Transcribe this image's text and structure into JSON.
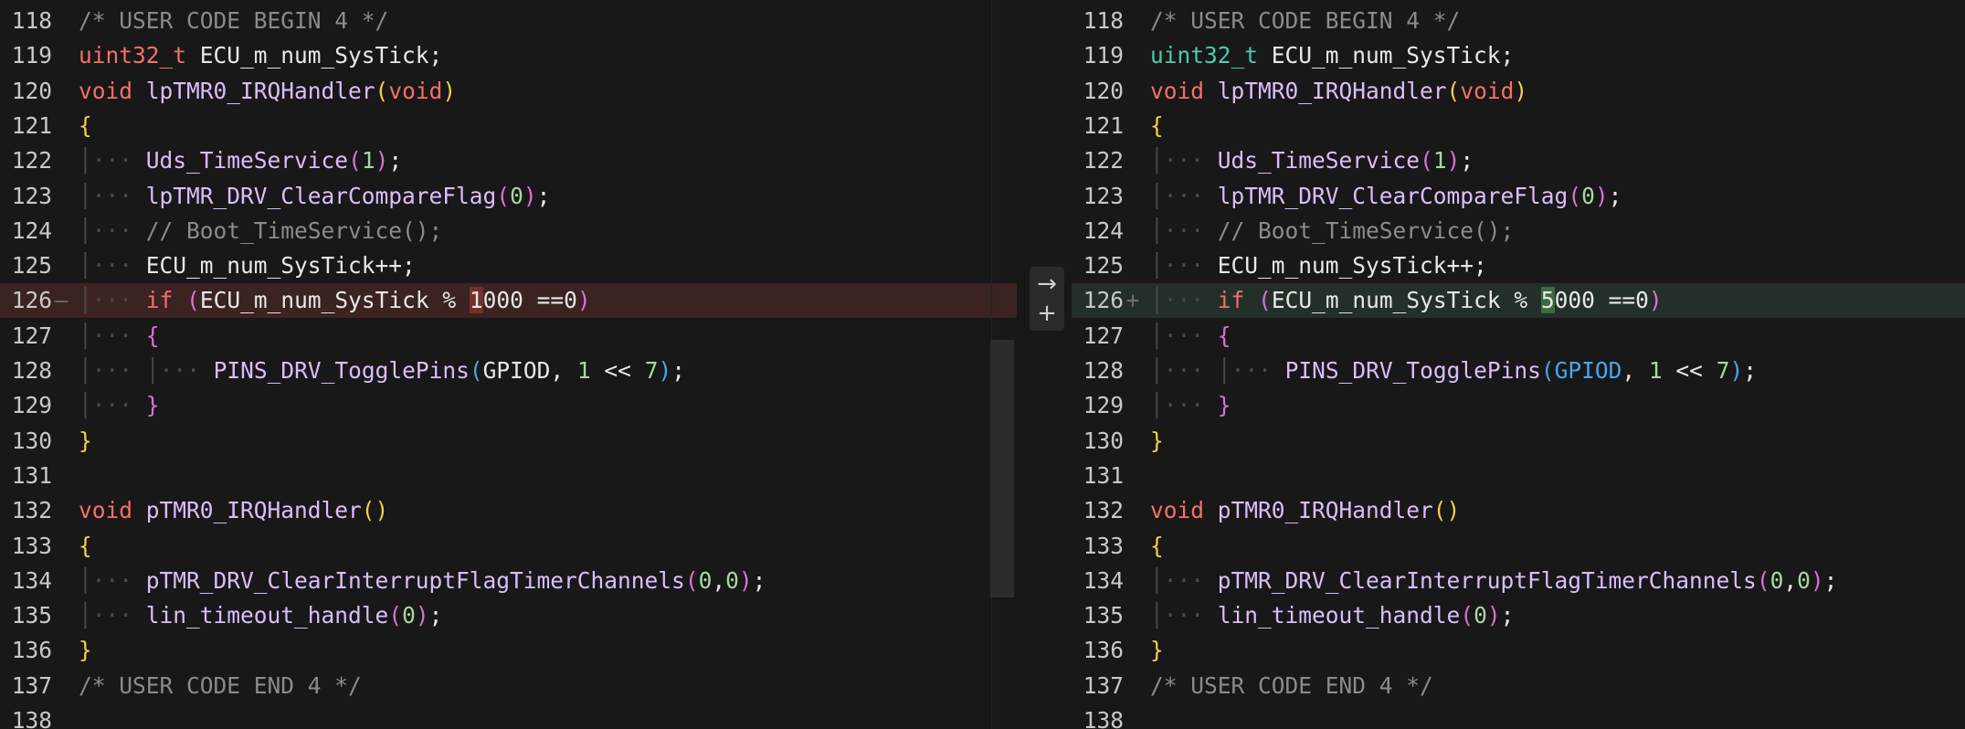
{
  "diff": {
    "left": {
      "lines": [
        {
          "num": "118",
          "marker": ""
        },
        {
          "num": "119",
          "marker": ""
        },
        {
          "num": "120",
          "marker": ""
        },
        {
          "num": "121",
          "marker": ""
        },
        {
          "num": "122",
          "marker": ""
        },
        {
          "num": "123",
          "marker": ""
        },
        {
          "num": "124",
          "marker": ""
        },
        {
          "num": "125",
          "marker": ""
        },
        {
          "num": "126",
          "marker": "—"
        },
        {
          "num": "127",
          "marker": ""
        },
        {
          "num": "128",
          "marker": ""
        },
        {
          "num": "129",
          "marker": ""
        },
        {
          "num": "130",
          "marker": ""
        },
        {
          "num": "131",
          "marker": ""
        },
        {
          "num": "132",
          "marker": ""
        },
        {
          "num": "133",
          "marker": ""
        },
        {
          "num": "134",
          "marker": ""
        },
        {
          "num": "135",
          "marker": ""
        },
        {
          "num": "136",
          "marker": ""
        },
        {
          "num": "137",
          "marker": ""
        },
        {
          "num": "138",
          "marker": ""
        }
      ],
      "changed_value": "1000"
    },
    "right": {
      "lines": [
        {
          "num": "118",
          "marker": ""
        },
        {
          "num": "119",
          "marker": ""
        },
        {
          "num": "120",
          "marker": ""
        },
        {
          "num": "121",
          "marker": ""
        },
        {
          "num": "122",
          "marker": ""
        },
        {
          "num": "123",
          "marker": ""
        },
        {
          "num": "124",
          "marker": ""
        },
        {
          "num": "125",
          "marker": ""
        },
        {
          "num": "126",
          "marker": "+"
        },
        {
          "num": "127",
          "marker": ""
        },
        {
          "num": "128",
          "marker": ""
        },
        {
          "num": "129",
          "marker": ""
        },
        {
          "num": "130",
          "marker": ""
        },
        {
          "num": "131",
          "marker": ""
        },
        {
          "num": "132",
          "marker": ""
        },
        {
          "num": "133",
          "marker": ""
        },
        {
          "num": "134",
          "marker": ""
        },
        {
          "num": "135",
          "marker": ""
        },
        {
          "num": "136",
          "marker": ""
        },
        {
          "num": "137",
          "marker": ""
        },
        {
          "num": "138",
          "marker": ""
        }
      ],
      "changed_value": "5000"
    },
    "code": {
      "l118": "/* USER CODE BEGIN 4 */",
      "l119_type": "uint32_t",
      "l119_rest": " ECU_m_num_SysTick;",
      "l120_void": "void",
      "l120_fn": "lpTMR0_IRQHandler",
      "l120_param": "void",
      "l122_fn": "Uds_TimeService",
      "l122_arg": "1",
      "l123_fn": "lpTMR_DRV_ClearCompareFlag",
      "l123_arg": "0",
      "l124_comment": "// Boot_TimeService();",
      "l125_stmt": "ECU_m_num_SysTick++;",
      "l126_if": "if",
      "l126_var": "ECU_m_num_SysTick % ",
      "l126_rest_left": "000 ==0",
      "l126_rest_right": "000 ==0",
      "l128_fn": "PINS_DRV_TogglePins",
      "l128_arg1": "GPIOD",
      "l128_num1": "1",
      "l128_op": " << ",
      "l128_num2": "7",
      "l132_void": "void",
      "l132_fn": "pTMR0_IRQHandler",
      "l134_fn": "pTMR_DRV_ClearInterruptFlagTimerChannels",
      "l134_a": "0",
      "l134_b": "0",
      "l135_fn": "lin_timeout_handle",
      "l135_arg": "0",
      "l137": "/* USER CODE END 4 */"
    },
    "actions": {
      "apply_icon": "arrow-right-icon",
      "apply_glyph": "→",
      "add_icon": "plus-icon",
      "add_glyph": "+"
    },
    "colors": {
      "background": "#181818",
      "deleted_line": "#3b2322",
      "added_line": "#23302a",
      "deleted_char": "#75302c",
      "added_char": "#3f6a3a"
    }
  }
}
